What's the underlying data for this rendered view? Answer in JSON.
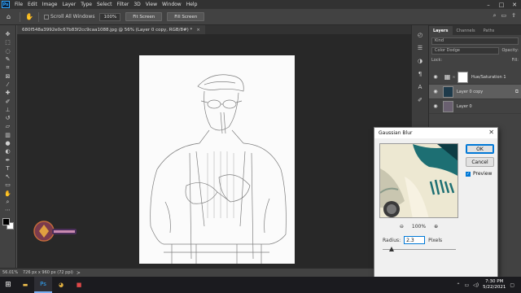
{
  "app": {
    "logo_text": "Ps"
  },
  "menu": [
    "File",
    "Edit",
    "Image",
    "Layer",
    "Type",
    "Select",
    "Filter",
    "3D",
    "View",
    "Window",
    "Help"
  ],
  "options": {
    "scroll_all_windows": "Scroll All Windows",
    "zoom_value": "100%",
    "fit_screen": "Fit Screen",
    "fill_screen": "Fill Screen"
  },
  "document": {
    "tab_title": "680f548a3992e0c67b83f2cc9caa1088.jpg @ 56% (Layer 0 copy, RGB/8#) *",
    "close_symbol": "×"
  },
  "status": {
    "zoom": "56.01%",
    "info": "726 px x 960 px (72 ppi)",
    "arrow": ">"
  },
  "layers_panel": {
    "tabs": [
      "Layers",
      "Channels",
      "Paths"
    ],
    "active_tab": "Layers",
    "filter_kind": "Kind",
    "blend_mode": "Color Dodge",
    "opacity_label": "Opacity:",
    "lock_label": "Lock:",
    "fill_label": "Fill:",
    "layers": [
      {
        "name": "Hue/Saturation 1",
        "type": "adjustment",
        "selected": false
      },
      {
        "name": "Layer 0 copy",
        "type": "image",
        "selected": true
      },
      {
        "name": "Layer 0",
        "type": "image",
        "selected": false
      }
    ]
  },
  "dialog": {
    "title": "Gaussian Blur",
    "ok": "OK",
    "cancel": "Cancel",
    "preview_label": "Preview",
    "preview_checked": true,
    "zoom": "100%",
    "radius_label": "Radius:",
    "radius_value": "2.3",
    "radius_unit": "Pixels",
    "radius_slider_fraction": 0.12
  },
  "taskbar": {
    "time": "7:30 PM",
    "date": "5/22/2021"
  },
  "colors": {
    "foreground": "#000000",
    "background": "#ffffff",
    "accent": "#31a8ff"
  }
}
